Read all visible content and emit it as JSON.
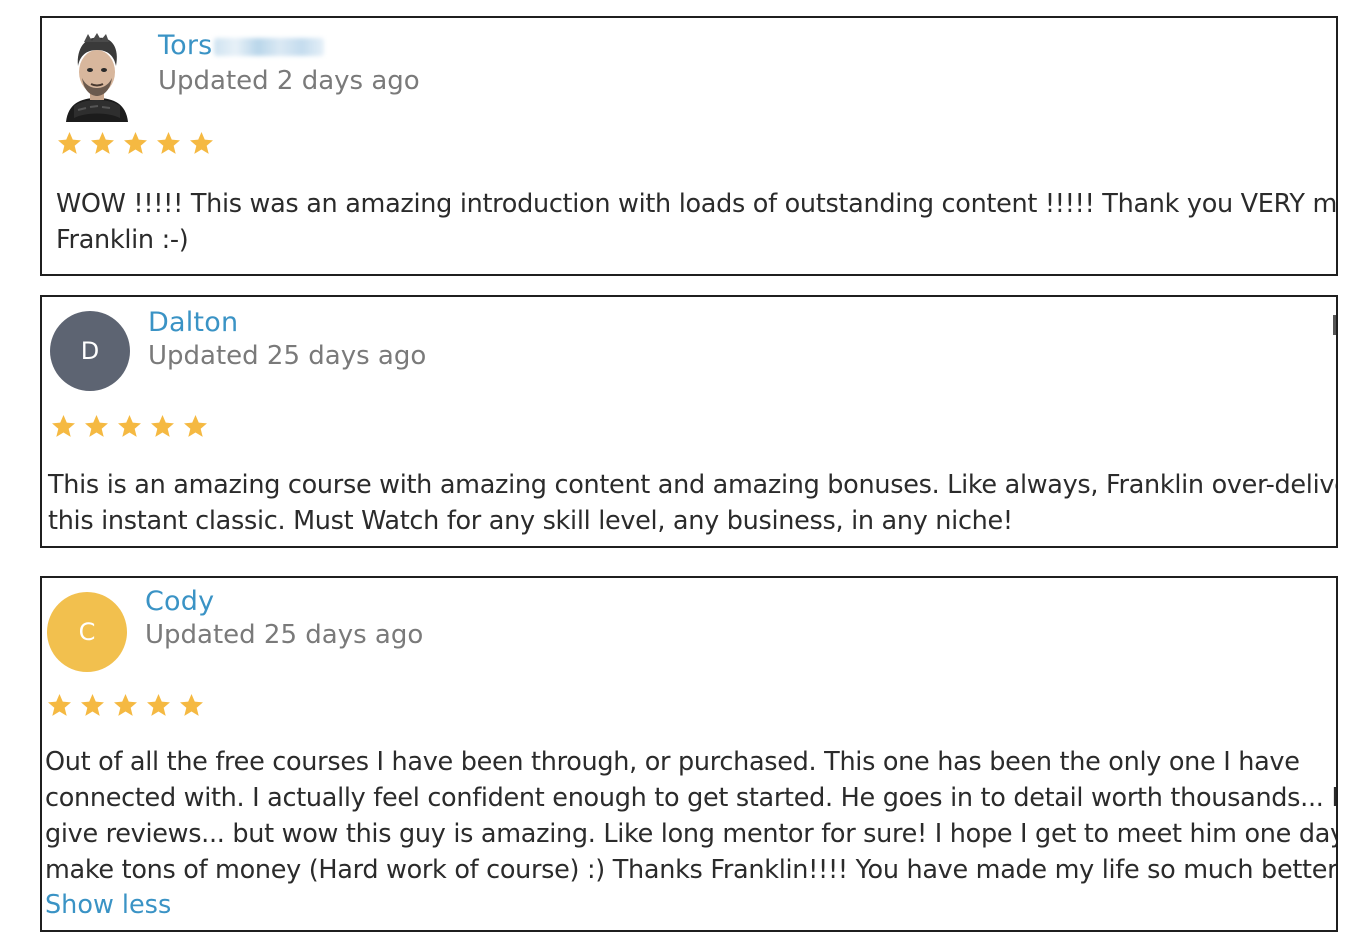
{
  "reviews": [
    {
      "name": "Tors",
      "updated": "Updated 2 days ago",
      "rating": 5,
      "avatar": {
        "type": "photo",
        "icon": "user-photo-icon"
      },
      "lines": [
        "WOW !!!!! This was an amazing introduction with loads of outstanding content !!!!! Thank you VERY much",
        "Franklin :-)"
      ]
    },
    {
      "name": "Dalton",
      "updated": "Updated 25 days ago",
      "rating": 5,
      "avatar": {
        "type": "initial",
        "initial": "D",
        "color": "#5d6472"
      },
      "lines": [
        "This is an amazing course with amazing content and amazing bonuses. Like always, Franklin over-delivers in",
        "this instant classic. Must Watch for any skill level, any business, in any niche!"
      ]
    },
    {
      "name": "Cody",
      "updated": "Updated 25 days ago",
      "rating": 5,
      "avatar": {
        "type": "initial",
        "initial": "C",
        "color": "#f2c04e"
      },
      "lines": [
        "Out of all the free courses I have been through, or purchased. This one has been the only one I have",
        "connected with. I actually feel confident enough to get started. He goes in to detail worth thousands... I neve",
        "give reviews... but wow this guy is amazing. Like long mentor for sure! I hope I get to meet him one day afte",
        "make tons of money (Hard work of course) :) Thanks Franklin!!!! You have made my life so much better!"
      ],
      "show_less": "Show less"
    }
  ],
  "colors": {
    "star": "#f5b942",
    "link": "#3a93c5",
    "meta": "#7a7a7a"
  }
}
